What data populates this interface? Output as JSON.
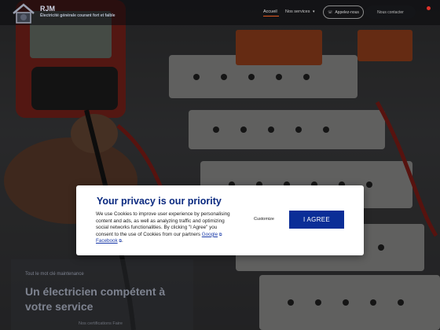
{
  "header": {
    "brand": "RJM",
    "tagline": "Électricité générale courant fort et faible",
    "nav": [
      {
        "label": "Accueil"
      },
      {
        "label": "Nos services"
      }
    ],
    "call_button_label": "Appelez-nous",
    "contact_button_label": "Nous contacter"
  },
  "hero": {
    "kicker": "Tout le mot clé maintenance",
    "title": "Un électricien compétent à votre service",
    "subtitle": "Nos certifications    Faire"
  },
  "consent": {
    "title": "Your privacy is our priority",
    "body_text": "We use Cookies to improve user experience by personalising content and ads, as well as analyzing traffic and optimizing social networks functionalities. By clicking \"I Agree\" you consent to the use of Cookies from our partners",
    "link_google": "Google",
    "link_facebook": "Facebook",
    "customize_label": "Customize",
    "agree_label": "I AGREE"
  },
  "colors": {
    "consent_title": "#0b2a80",
    "agree_button": "#0b2e97",
    "accent_underline": "#e05a20"
  },
  "icons": {
    "logo": "house-logo-icon",
    "phone": "phone-icon",
    "external_link": "external-link-icon",
    "caret": "chevron-down-icon"
  }
}
